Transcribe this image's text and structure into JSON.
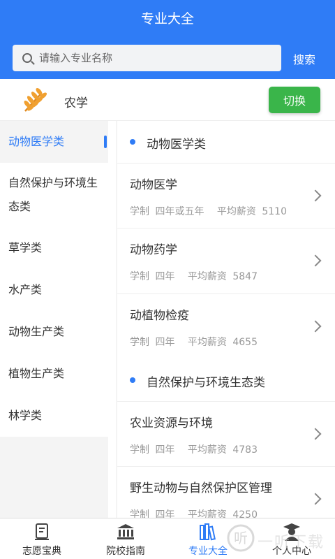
{
  "header": {
    "title": "专业大全",
    "search_placeholder": "请输入专业名称",
    "search_button": "搜索"
  },
  "category": {
    "icon": "wheat-icon",
    "name": "农学",
    "switch_button": "切换"
  },
  "sidebar": {
    "items": [
      {
        "label": "动物医学类",
        "active": true
      },
      {
        "label": "自然保护与环境生态类",
        "active": false
      },
      {
        "label": "草学类",
        "active": false
      },
      {
        "label": "水产类",
        "active": false
      },
      {
        "label": "动物生产类",
        "active": false
      },
      {
        "label": "植物生产类",
        "active": false
      },
      {
        "label": "林学类",
        "active": false
      }
    ]
  },
  "content": {
    "sections": [
      {
        "title": "动物医学类",
        "majors": [
          {
            "name": "动物医学",
            "duration_label": "学制",
            "duration": "四年或五年",
            "salary_label": "平均薪资",
            "salary": "5110"
          },
          {
            "name": "动物药学",
            "duration_label": "学制",
            "duration": "四年",
            "salary_label": "平均薪资",
            "salary": "5847"
          },
          {
            "name": "动植物检疫",
            "duration_label": "学制",
            "duration": "四年",
            "salary_label": "平均薪资",
            "salary": "4655"
          }
        ]
      },
      {
        "title": "自然保护与环境生态类",
        "majors": [
          {
            "name": "农业资源与环境",
            "duration_label": "学制",
            "duration": "四年",
            "salary_label": "平均薪资",
            "salary": "4783"
          },
          {
            "name": "野生动物与自然保护区管理",
            "duration_label": "学制",
            "duration": "四年",
            "salary_label": "平均薪资",
            "salary": "4250"
          }
        ]
      }
    ]
  },
  "tabbar": {
    "items": [
      {
        "label": "志愿宝典",
        "icon": "book-icon",
        "active": false
      },
      {
        "label": "院校指南",
        "icon": "university-icon",
        "active": false
      },
      {
        "label": "专业大全",
        "icon": "books-icon",
        "active": true
      },
      {
        "label": "个人中心",
        "icon": "graduate-icon",
        "active": false
      }
    ]
  },
  "watermark": {
    "text": "一听下载"
  },
  "colors": {
    "primary": "#2f7cf6",
    "switch": "#3ab54a",
    "wheat": "#f0a030"
  }
}
